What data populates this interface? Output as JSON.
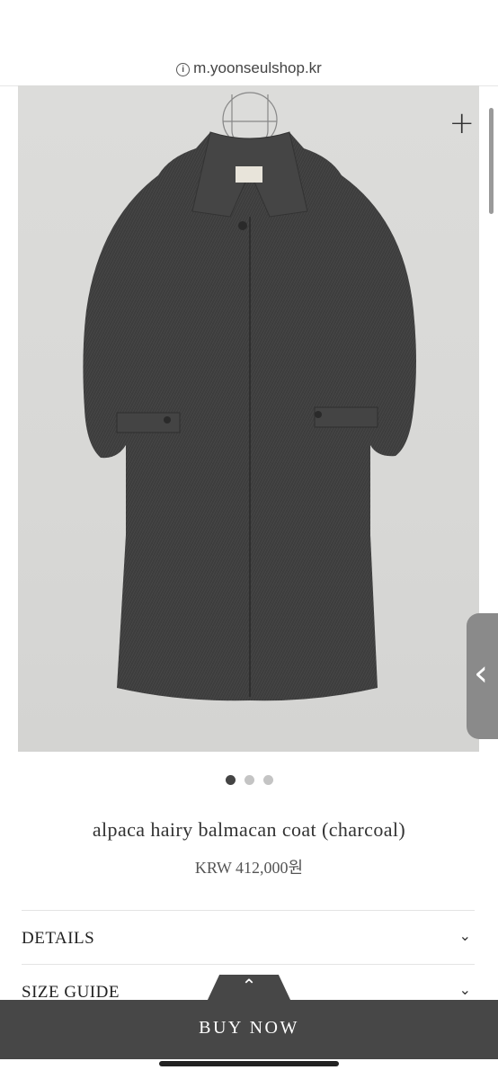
{
  "browser": {
    "url": "m.yoonseulshop.kr",
    "info_icon": "i"
  },
  "product": {
    "name": "alpaca hairy balmacan coat (charcoal)",
    "price": "KRW 412,000원",
    "image_count": 3,
    "active_image": 1
  },
  "gallery": {
    "zoom_label": "+"
  },
  "accordion": [
    {
      "label": "DETAILS",
      "icon": "chevron-down-icon"
    },
    {
      "label": "SIZE GUIDE",
      "icon": "chevron-down-icon"
    }
  ],
  "buy_bar": {
    "label": "BUY NOW",
    "toggle_icon": "chevron-up-icon"
  },
  "edge_handle": {
    "icon": "chevron-left-icon"
  },
  "colors": {
    "coat": "#3c3c3c",
    "background_photo": "#d9d9d7",
    "buy_bar": "#474747"
  }
}
